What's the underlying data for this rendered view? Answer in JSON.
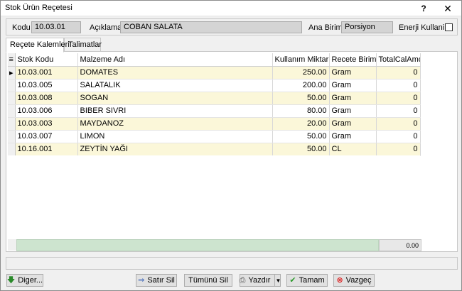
{
  "window": {
    "title": "Stok Ürün Reçetesi",
    "help": "?",
    "close": "✕"
  },
  "header": {
    "kodu_label": "Kodu",
    "kodu_value": "10.03.01",
    "aciklama_label": "Açıklama",
    "aciklama_value": "COBAN SALATA",
    "anabirim_label": "Ana Birim",
    "anabirim_value": "Porsiyon",
    "enerji_label": "Enerji Kullanir"
  },
  "tabs": [
    {
      "label": "Reçete Kalemleri"
    },
    {
      "label": "Talimatlar"
    }
  ],
  "grid": {
    "columns": [
      "Stok Kodu",
      "Malzeme Adı",
      "Kullanım Miktarı",
      "Recete Birimi",
      "TotalCalAmo"
    ],
    "rows": [
      [
        "10.03.001",
        "DOMATES",
        "250.00",
        "Gram",
        "0"
      ],
      [
        "10.03.005",
        "SALATALIK",
        "200.00",
        "Gram",
        "0"
      ],
      [
        "10.03.008",
        "SOGAN",
        "50.00",
        "Gram",
        "0"
      ],
      [
        "10.03.006",
        "BIBER SIVRI",
        "80.00",
        "Gram",
        "0"
      ],
      [
        "10.03.003",
        "MAYDANOZ",
        "20.00",
        "Gram",
        "0"
      ],
      [
        "10.03.007",
        "LIMON",
        "50.00",
        "Gram",
        "0"
      ],
      [
        "10.16.001",
        "ZEYTİN YAĞI",
        "50.00",
        "CL",
        "0"
      ]
    ],
    "footer_total": "0.00",
    "selected_row": 0
  },
  "buttons": {
    "diger": "Diger...",
    "satir_sil": "Satır Sil",
    "tumunu_sil": "Tümünü Sil",
    "yazdir": "Yazdır",
    "tamam": "Tamam",
    "vazgec": "Vazgeç"
  },
  "colors": {
    "row_odd": "#fbf7d9",
    "footer_green": "#cde4cf"
  }
}
